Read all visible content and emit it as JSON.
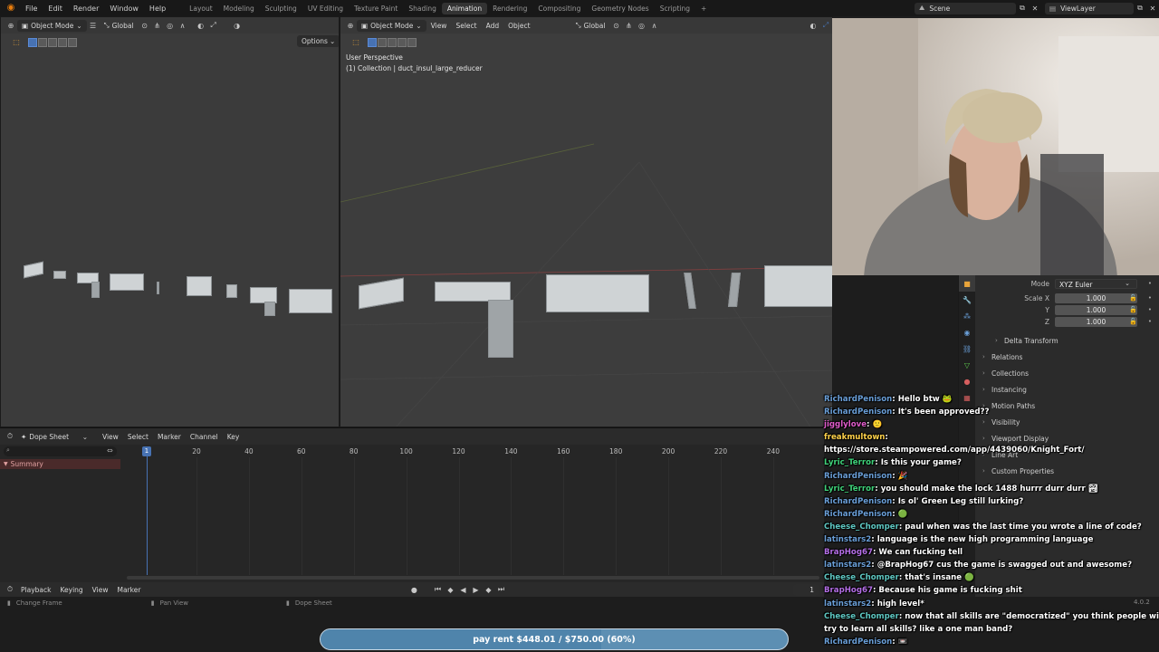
{
  "menu": {
    "items": [
      "File",
      "Edit",
      "Render",
      "Window",
      "Help"
    ],
    "workspaces": [
      "Layout",
      "Modeling",
      "Sculpting",
      "UV Editing",
      "Texture Paint",
      "Shading",
      "Animation",
      "Rendering",
      "Compositing",
      "Geometry Nodes",
      "Scripting"
    ],
    "active_workspace": "Animation",
    "add_tab": "+",
    "scene": "Scene",
    "view_layer": "ViewLayer"
  },
  "left_viewport": {
    "mode": "Object Mode",
    "orientation": "Global",
    "options": "Options"
  },
  "main_viewport": {
    "mode": "Object Mode",
    "menus": [
      "View",
      "Select",
      "Add",
      "Object"
    ],
    "orientation": "Global",
    "perspective": "User Perspective",
    "collection": "(1) Collection | duct_insul_large_reducer"
  },
  "dope_sheet": {
    "editor": "Dope Sheet",
    "menus": [
      "View",
      "Select",
      "Marker",
      "Channel",
      "Key"
    ],
    "frame_numbers": [
      "20",
      "40",
      "60",
      "80",
      "100",
      "120",
      "140",
      "160",
      "180",
      "200",
      "220",
      "240"
    ],
    "current_frame": "1",
    "summary": "Summary"
  },
  "playback": {
    "menus": [
      "Playback",
      "Keying",
      "View",
      "Marker"
    ],
    "frame": "1"
  },
  "status": {
    "change_frame": "Change Frame",
    "pan_view": "Pan View",
    "dope_sheet": "Dope Sheet",
    "version": "4.0.2"
  },
  "properties": {
    "mode_label": "Mode",
    "mode_value": "XYZ Euler",
    "scale_label": "Scale X",
    "scale_x": "1.000",
    "y_label": "Y",
    "scale_y": "1.000",
    "z_label": "Z",
    "scale_z": "1.000",
    "sections": [
      "Delta Transform",
      "Relations",
      "Collections",
      "Instancing",
      "Motion Paths",
      "Visibility",
      "Viewport Display",
      "Line Art",
      "Custom Properties"
    ]
  },
  "chat": [
    {
      "user": "RichardPenison",
      "color": "#6a9fd8",
      "text": "Hello btw 🐸"
    },
    {
      "user": "RichardPenison",
      "color": "#6a9fd8",
      "text": "It's been approved??"
    },
    {
      "user": "jigglylove",
      "color": "#e05ccb",
      "text": "🙂"
    },
    {
      "user": "freakmultown",
      "color": "#ffd24a",
      "text": ""
    },
    {
      "user": "",
      "color": "#ffffff",
      "text": "https://store.steampowered.com/app/4439060/Knight_Fort/"
    },
    {
      "user": "Lyric_Terror",
      "color": "#3fd27a",
      "text": "Is this your game?"
    },
    {
      "user": "RichardPenison",
      "color": "#6a9fd8",
      "text": "🎉"
    },
    {
      "user": "Lyric_Terror",
      "color": "#3fd27a",
      "text": "you should make the lock 1488 hurrr durr durr 🏞"
    },
    {
      "user": "RichardPenison",
      "color": "#6a9fd8",
      "text": "Is ol' Green Leg still lurking?"
    },
    {
      "user": "RichardPenison",
      "color": "#6a9fd8",
      "text": "🟢"
    },
    {
      "user": "Cheese_Chomper",
      "color": "#5ec7c2",
      "text": "paul when was the last time you wrote a line of code?"
    },
    {
      "user": "latinstars2",
      "color": "#6a9fd8",
      "text": "language is the new high programming language"
    },
    {
      "user": "BrapHog67",
      "color": "#b46ee6",
      "text": "We can fucking tell"
    },
    {
      "user": "latinstars2",
      "color": "#6a9fd8",
      "text": "@BrapHog67 cus the game is swagged out and awesome?"
    },
    {
      "user": "Cheese_Chomper",
      "color": "#5ec7c2",
      "text": "that's insane 🟢"
    },
    {
      "user": "BrapHog67",
      "color": "#b46ee6",
      "text": "Because his game is fucking shit"
    },
    {
      "user": "latinstars2",
      "color": "#6a9fd8",
      "text": "high level*"
    },
    {
      "user": "Cheese_Chomper",
      "color": "#5ec7c2",
      "text": "now that all skills are \"democratized\" you think people will"
    },
    {
      "user": "",
      "color": "#ffffff",
      "text": "try to learn all skills? like a one man band?"
    },
    {
      "user": "RichardPenison",
      "color": "#6a9fd8",
      "text": "📼"
    }
  ],
  "goal": {
    "label": "pay rent $448.01 / $750.00 (60%)",
    "progress": 0.6
  },
  "colors": {
    "accent": "#4772b3",
    "active_tab": "#333333",
    "goal_bar": "#5d8fb3"
  }
}
